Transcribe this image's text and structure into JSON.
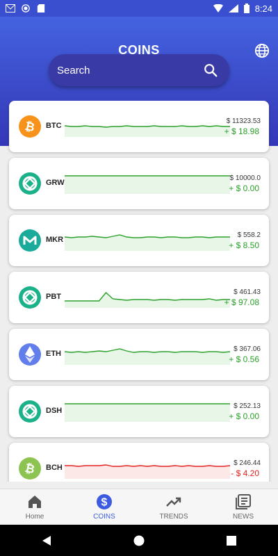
{
  "status": {
    "time": "8:24"
  },
  "header": {
    "title": "COINS"
  },
  "search": {
    "placeholder": "Search"
  },
  "coins": [
    {
      "symbol": "BTC",
      "price": "$ 11323.53",
      "change": "+ $ 18.98",
      "trend": "up",
      "logo_color": "#f7931a",
      "logo_glyph": "₿"
    },
    {
      "symbol": "GRWI",
      "price": "$ 10000.0",
      "change": "+ $ 0.00",
      "trend": "up",
      "logo_color": "#1bb28a",
      "logo_glyph": "generic"
    },
    {
      "symbol": "MKR",
      "price": "$ 558.2",
      "change": "+ $ 8.50",
      "trend": "up",
      "logo_color": "#1aab9b",
      "logo_glyph": "M"
    },
    {
      "symbol": "PBT",
      "price": "$ 461.43",
      "change": "+ $ 97.08",
      "trend": "up",
      "logo_color": "#1bb28a",
      "logo_glyph": "generic"
    },
    {
      "symbol": "ETH",
      "price": "$ 367.06",
      "change": "+ $ 0.56",
      "trend": "up",
      "logo_color": "#627eea",
      "logo_glyph": "eth"
    },
    {
      "symbol": "DSH",
      "price": "$ 252.13",
      "change": "+ $ 0.00",
      "trend": "up",
      "logo_color": "#1bb28a",
      "logo_glyph": "generic"
    },
    {
      "symbol": "BCH",
      "price": "$ 246.44",
      "change": "- $ 4.20",
      "trend": "down",
      "logo_color": "#8dc351",
      "logo_glyph": "₿"
    }
  ],
  "colors": {
    "up": "#2aa02a",
    "up_fill": "#e8f6e8",
    "down": "#e02020",
    "down_fill": "#fde8e8",
    "accent": "#3c5be0"
  },
  "nav": [
    {
      "label": "Home",
      "icon": "home-icon"
    },
    {
      "label": "COINS",
      "icon": "dollar-icon",
      "active": true
    },
    {
      "label": "TRENDS",
      "icon": "trend-icon"
    },
    {
      "label": "NEWS",
      "icon": "news-icon"
    }
  ]
}
